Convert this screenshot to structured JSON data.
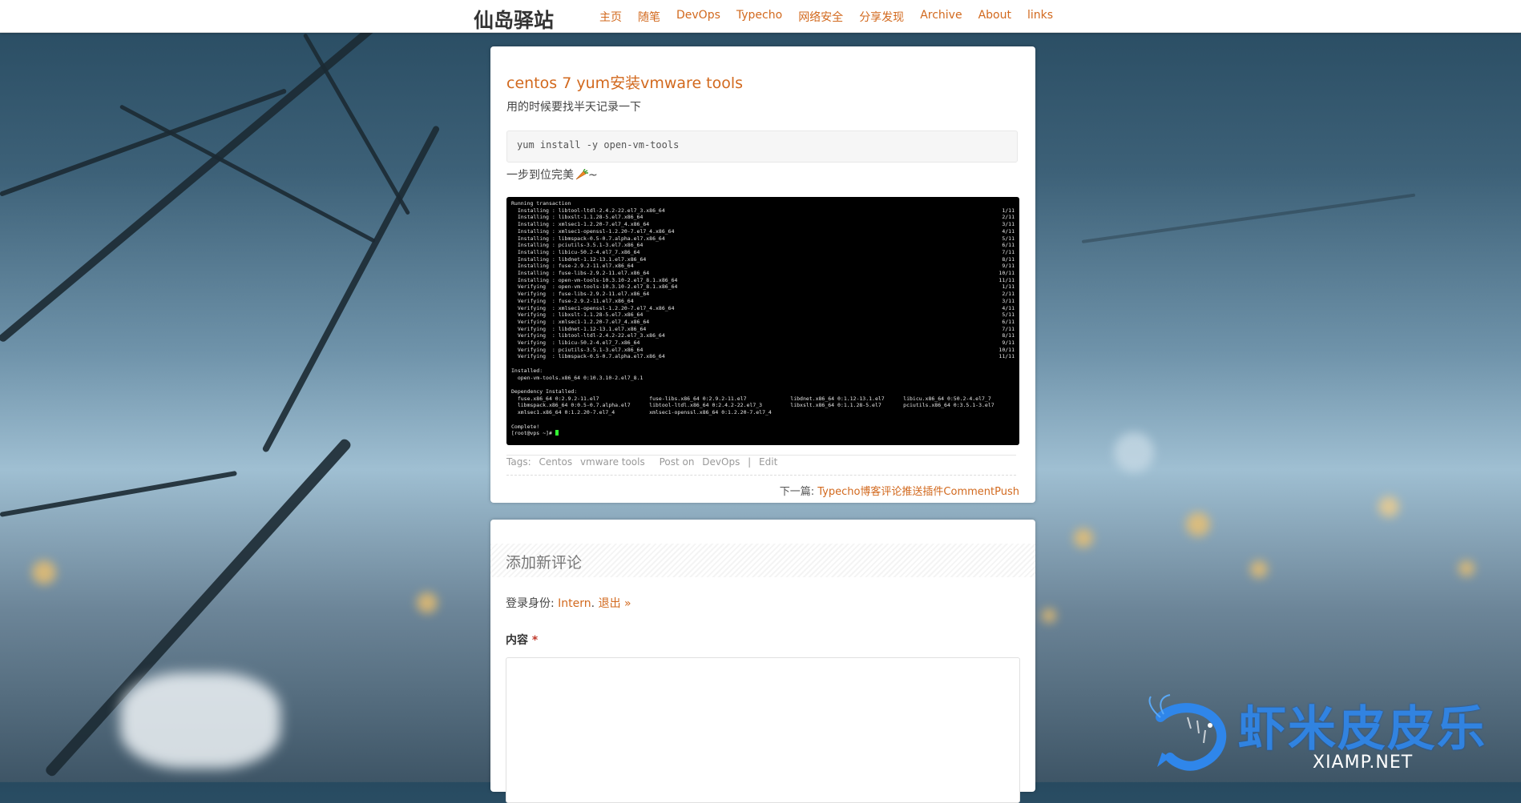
{
  "header": {
    "brand": "仙岛驿站",
    "nav": [
      "主页",
      "随笔",
      "DevOps",
      "Typecho",
      "网络安全",
      "分享发现",
      "Archive",
      "About",
      "links"
    ]
  },
  "post": {
    "title": "centos 7 yum安装vmware tools",
    "intro": "用的时候要找半天记录一下",
    "code": "yum install -y open-vm-tools",
    "done_text": "一步到位完美",
    "done_suffix": "~",
    "terminal": {
      "header": "Running transaction",
      "rows": [
        {
          "text": "  Installing : libtool-ltdl-2.4.2-22.el7_3.x86_64",
          "count": "1/11"
        },
        {
          "text": "  Installing : libxslt-1.1.28-5.el7.x86_64",
          "count": "2/11"
        },
        {
          "text": "  Installing : xmlsec1-1.2.20-7.el7_4.x86_64",
          "count": "3/11"
        },
        {
          "text": "  Installing : xmlsec1-openssl-1.2.20-7.el7_4.x86_64",
          "count": "4/11"
        },
        {
          "text": "  Installing : libmspack-0.5-0.7.alpha.el7.x86_64",
          "count": "5/11"
        },
        {
          "text": "  Installing : pciutils-3.5.1-3.el7.x86_64",
          "count": "6/11"
        },
        {
          "text": "  Installing : libicu-50.2-4.el7_7.x86_64",
          "count": "7/11"
        },
        {
          "text": "  Installing : libdnet-1.12-13.1.el7.x86_64",
          "count": "8/11"
        },
        {
          "text": "  Installing : fuse-2.9.2-11.el7.x86_64",
          "count": "9/11"
        },
        {
          "text": "  Installing : fuse-libs-2.9.2-11.el7.x86_64",
          "count": "10/11"
        },
        {
          "text": "  Installing : open-vm-tools-10.3.10-2.el7_8.1.x86_64",
          "count": "11/11"
        },
        {
          "text": "  Verifying  : open-vm-tools-10.3.10-2.el7_8.1.x86_64",
          "count": "1/11"
        },
        {
          "text": "  Verifying  : fuse-libs-2.9.2-11.el7.x86_64",
          "count": "2/11"
        },
        {
          "text": "  Verifying  : fuse-2.9.2-11.el7.x86_64",
          "count": "3/11"
        },
        {
          "text": "  Verifying  : xmlsec1-openssl-1.2.20-7.el7_4.x86_64",
          "count": "4/11"
        },
        {
          "text": "  Verifying  : libxslt-1.1.28-5.el7.x86_64",
          "count": "5/11"
        },
        {
          "text": "  Verifying  : xmlsec1-1.2.20-7.el7_4.x86_64",
          "count": "6/11"
        },
        {
          "text": "  Verifying  : libdnet-1.12-13.1.el7.x86_64",
          "count": "7/11"
        },
        {
          "text": "  Verifying  : libtool-ltdl-2.4.2-22.el7_3.x86_64",
          "count": "8/11"
        },
        {
          "text": "  Verifying  : libicu-50.2-4.el7_7.x86_64",
          "count": "9/11"
        },
        {
          "text": "  Verifying  : pciutils-3.5.1-3.el7.x86_64",
          "count": "10/11"
        },
        {
          "text": "  Verifying  : libmspack-0.5-0.7.alpha.el7.x86_64",
          "count": "11/11"
        }
      ],
      "installed_header": "Installed:",
      "installed": "  open-vm-tools.x86_64 0:10.3.10-2.el7_8.1",
      "dependency_header": "Dependency Installed:",
      "dependencies": [
        "  fuse.x86_64 0:2.9.2-11.el7                fuse-libs.x86_64 0:2.9.2-11.el7              libdnet.x86_64 0:1.12-13.1.el7      libicu.x86_64 0:50.2-4.el7_7",
        "  libmspack.x86_64 0:0.5-0.7.alpha.el7      libtool-ltdl.x86_64 0:2.4.2-22.el7_3         libxslt.x86_64 0:1.1.28-5.el7       pciutils.x86_64 0:3.5.1-3.el7",
        "  xmlsec1.x86_64 0:1.2.20-7.el7_4           xmlsec1-openssl.x86_64 0:1.2.20-7.el7_4"
      ],
      "complete": "Complete!",
      "prompt": "[root@vps ~]# "
    },
    "tags_label": "Tags:",
    "tags": [
      "Centos",
      "vmware tools"
    ],
    "post_on_label": "Post on",
    "category": "DevOps",
    "separator": "|",
    "edit_label": "Edit",
    "next_label": "下一篇:",
    "next_title": "Typecho博客评论推送插件CommentPush"
  },
  "comment": {
    "heading": "添加新评论",
    "login_prefix": "登录身份:",
    "username": "Intern",
    "logout": "退出 »",
    "content_label": "内容",
    "required_mark": "*"
  },
  "watermark": {
    "text": "虾米皮皮乐",
    "sub": "XIAMP.NET"
  },
  "colors": {
    "accent": "#d2691e",
    "watermark": "#2f86ea"
  }
}
